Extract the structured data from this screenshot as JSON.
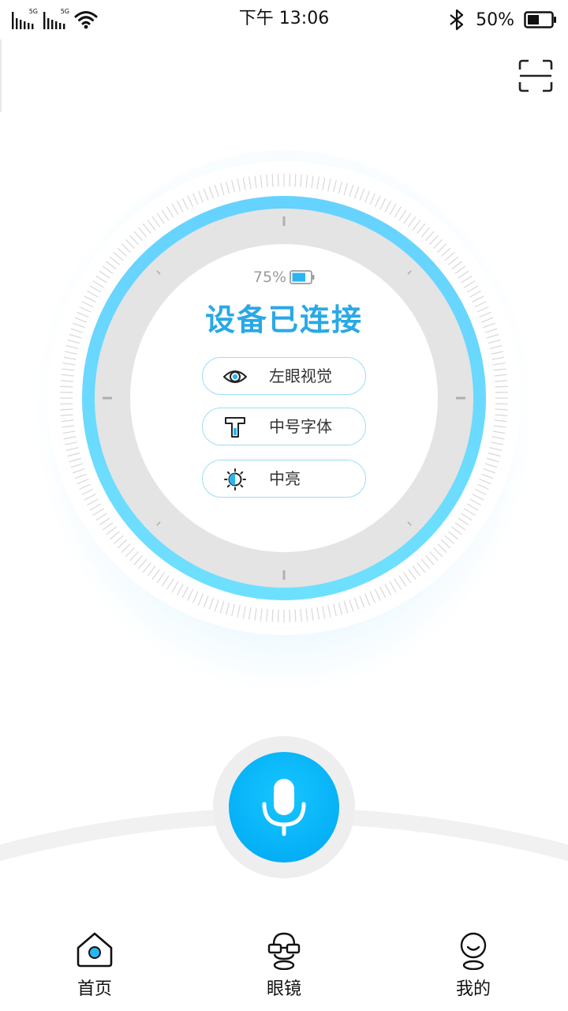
{
  "status_bar": {
    "signal1_tag": "5G",
    "signal2_tag": "5G",
    "time": "下午 13:06",
    "battery_percent": "50%"
  },
  "device": {
    "battery_percent": "75%",
    "battery_level": 0.75,
    "status_title": "设备已连接",
    "settings": [
      {
        "label": "左眼视觉",
        "icon": "eye-icon"
      },
      {
        "label": "中号字体",
        "icon": "font-size-icon"
      },
      {
        "label": "中亮",
        "icon": "brightness-icon"
      }
    ]
  },
  "mic": {
    "icon": "microphone-icon"
  },
  "tabs": [
    {
      "label": "首页",
      "icon": "home-icon",
      "active": true
    },
    {
      "label": "眼镜",
      "icon": "glasses-icon",
      "active": false
    },
    {
      "label": "我的",
      "icon": "profile-icon",
      "active": false
    }
  ],
  "colors": {
    "accent": "#2aa8e6",
    "ring": "#66d6ff",
    "mic": "#05b0f6",
    "pill_border": "#9fdcf5"
  }
}
